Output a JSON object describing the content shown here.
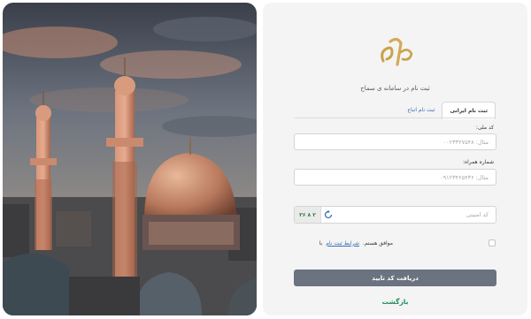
{
  "logo": {
    "text": "سماح"
  },
  "subtitle": "ثبت نام در سامانه ی سماح",
  "tabs": [
    {
      "label": "ثبت نام ایرانی",
      "active": true
    },
    {
      "label": "ثبت نام اتباع",
      "active": false
    }
  ],
  "form": {
    "national_code": {
      "label": "کد ملی:",
      "placeholder": "مثال: ۰۰۲۳۳۲۷۵۴۸",
      "value": ""
    },
    "phone": {
      "label": "شماره همراه:",
      "placeholder": "مثال: ۰۹۱۲۳۴۶۵۴۳۶",
      "value": ""
    },
    "captcha": {
      "placeholder": "کد امنیتی",
      "image_text": "۳۶ ۸ ۲"
    }
  },
  "terms": {
    "prefix": "با",
    "link": "شرایط ثبت نام",
    "suffix": "موافق هستم."
  },
  "submit_label": "دریافت کد تایید",
  "back_label": "بازگشت",
  "colors": {
    "panel_bg": "#f4f4f5",
    "submit_bg": "#6b7280",
    "back_text": "#1f8a5b",
    "link": "#3a6fb0",
    "logo_gold": "#c9a24a"
  },
  "icons": [
    "refresh-icon",
    "checkbox-icon"
  ]
}
